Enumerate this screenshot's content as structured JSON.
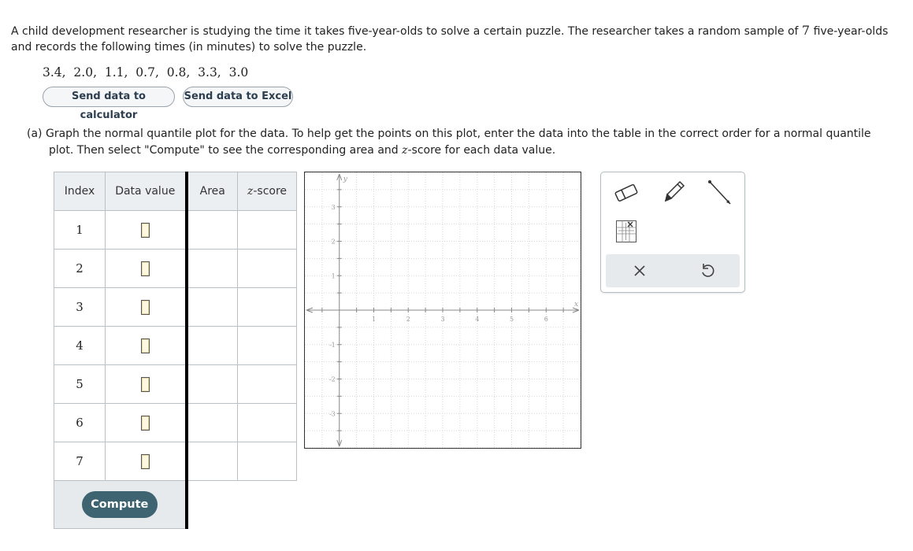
{
  "problem": {
    "text_before": "A child development researcher is studying the time it takes five-year-olds to solve a certain puzzle. The researcher takes a random sample of",
    "sample_size": "7",
    "text_after": "five-year-olds and records the following times (in minutes) to solve the puzzle."
  },
  "data_values": "3.4,  2.0,  1.1,  0.7,  0.8,  3.3,  3.0",
  "buttons": {
    "send_calculator": "Send data to calculator",
    "send_excel": "Send data to Excel",
    "compute": "Compute"
  },
  "part_a": {
    "label": "(a)",
    "line1_pre": "Graph the normal quantile plot for the data. To help get the points on this plot, enter the data into the table in the correct order for a normal quantile",
    "line2_pre": "plot. Then select \"Compute\" to see the corresponding area and ",
    "z_letter": "z",
    "line2_post": "-score for each data value."
  },
  "table": {
    "headers": {
      "index": "Index",
      "data_value": "Data value",
      "area": "Area",
      "z_letter": "z",
      "z_suffix": "-score"
    },
    "rows": [
      {
        "index": "1",
        "data_value": "",
        "area": "",
        "zscore": ""
      },
      {
        "index": "2",
        "data_value": "",
        "area": "",
        "zscore": ""
      },
      {
        "index": "3",
        "data_value": "",
        "area": "",
        "zscore": ""
      },
      {
        "index": "4",
        "data_value": "",
        "area": "",
        "zscore": ""
      },
      {
        "index": "5",
        "data_value": "",
        "area": "",
        "zscore": ""
      },
      {
        "index": "6",
        "data_value": "",
        "area": "",
        "zscore": ""
      },
      {
        "index": "7",
        "data_value": "",
        "area": "",
        "zscore": ""
      }
    ]
  },
  "graph": {
    "x_label": "x",
    "y_label": "y",
    "xlim": [
      -1,
      7
    ],
    "ylim": [
      -4,
      4
    ],
    "x_ticks": [
      "1",
      "2",
      "3",
      "4",
      "5",
      "6"
    ],
    "y_ticks": [
      "3",
      "2",
      "1",
      "-1",
      "-2",
      "-3"
    ]
  },
  "toolbox": {
    "tools": [
      "eraser-icon",
      "pencil-icon",
      "line-segment-icon",
      "point-grid-icon"
    ],
    "bar": [
      "close-icon",
      "undo-icon"
    ],
    "accent": "#3d6470"
  }
}
